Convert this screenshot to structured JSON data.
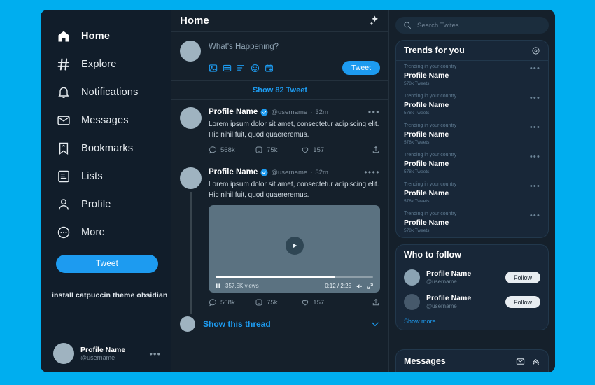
{
  "theme": {
    "page_background": "#00AEEF",
    "panel_background": "#15202b",
    "accent": "#1d9bf0"
  },
  "sidebar": {
    "items": [
      {
        "label": "Home",
        "icon": "home-icon"
      },
      {
        "label": "Explore",
        "icon": "hashtag-icon"
      },
      {
        "label": "Notifications",
        "icon": "bell-icon"
      },
      {
        "label": "Messages",
        "icon": "envelope-icon"
      },
      {
        "label": "Bookmarks",
        "icon": "bookmark-icon"
      },
      {
        "label": "Lists",
        "icon": "list-icon"
      },
      {
        "label": "Profile",
        "icon": "person-icon"
      },
      {
        "label": "More",
        "icon": "more-circle-icon"
      }
    ],
    "tweet_button": "Tweet",
    "note": "install catpuccin theme obsidian",
    "profile": {
      "name": "Profile Name",
      "handle": "@username",
      "menu": "•••"
    }
  },
  "main": {
    "title": "Home",
    "sparkle_icon": "sparkle-icon",
    "compose": {
      "placeholder": "What's Happening?",
      "tweet_button": "Tweet",
      "icons": [
        "image-icon",
        "gif-icon",
        "poll-icon",
        "emoji-icon",
        "schedule-icon"
      ]
    },
    "show_tweets": "Show 82 Tweet",
    "tweets": [
      {
        "name": "Profile Name",
        "handle": "@username",
        "time": "32m",
        "separator": "·",
        "text": "Lorem ipsum dolor sit amet, consectetur adipiscing elit. Hic nihil fuit, quod quaereremus.",
        "replies": "568k",
        "retweets": "75k",
        "likes": "157",
        "menu": "•••",
        "has_video": false
      },
      {
        "name": "Profile Name",
        "handle": "@username",
        "time": "32m",
        "separator": "·",
        "text": "Lorem ipsum dolor sit amet, consectetur adipiscing elit. Hic nihil fuit, quod quaereremus.",
        "replies": "568k",
        "retweets": "75k",
        "likes": "157",
        "menu": "••••",
        "has_video": true,
        "video": {
          "views": "357.5K views",
          "time": "0:12 / 2:25",
          "progress_percent": 76
        }
      }
    ],
    "show_thread": "Show this thread"
  },
  "right": {
    "search": {
      "placeholder": "Search Twites",
      "value": "",
      "icon": "search-icon"
    },
    "trends": {
      "title": "Trends for you",
      "settings_icon": "gear-icon",
      "items": [
        {
          "kicker": "Trending in your country",
          "name": "Profile Name",
          "count": "578k Tweets",
          "menu": "•••"
        },
        {
          "kicker": "Trending in your country",
          "name": "Profile Name",
          "count": "578k Tweets",
          "menu": "•••"
        },
        {
          "kicker": "Trending in your country",
          "name": "Profile Name",
          "count": "578k Tweets",
          "menu": "•••"
        },
        {
          "kicker": "Trending in your country",
          "name": "Profile Name",
          "count": "578k Tweets",
          "menu": "•••"
        },
        {
          "kicker": "Trending in your country",
          "name": "Profile Name",
          "count": "578k Tweets",
          "menu": "•••"
        },
        {
          "kicker": "Trending in your country",
          "name": "Profile Name",
          "count": "578k Tweets",
          "menu": "•••"
        }
      ]
    },
    "who_to_follow": {
      "title": "Who to follow",
      "users": [
        {
          "name": "Profile Name",
          "handle": "@username",
          "follow_label": "Follow"
        },
        {
          "name": "Profile Name",
          "handle": "@username",
          "follow_label": "Follow"
        }
      ],
      "show_more": "Show more"
    },
    "messages": {
      "title": "Messages",
      "compose_icon": "new-message-icon",
      "expand_icon": "chevron-up-icon"
    }
  }
}
